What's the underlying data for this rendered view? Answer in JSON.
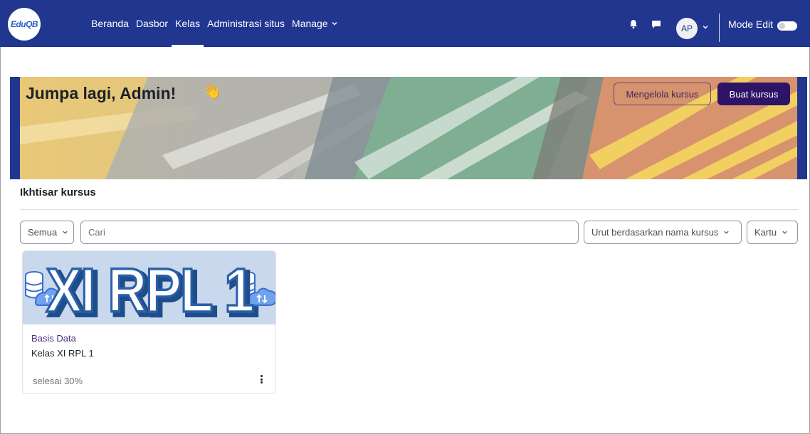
{
  "logo": {
    "text": "EduQB"
  },
  "nav": {
    "links": [
      "Beranda",
      "Dasbor",
      "Kelas",
      "Administrasi situs",
      "Manage"
    ],
    "active": "Kelas"
  },
  "user": {
    "initials": "AP"
  },
  "mode_edit_label": "Mode Edit",
  "banner": {
    "greeting": "Jumpa lagi, Admin!",
    "wave": "👋",
    "manage_button": "Mengelola kursus",
    "create_button": "Buat kursus"
  },
  "overview": {
    "title": "Ikhtisar kursus",
    "filter": "Semua",
    "search_placeholder": "Cari",
    "sort": "Urut berdasarkan nama kursus",
    "view": "Kartu"
  },
  "courses": [
    {
      "image_text": "XI RPL 1",
      "category": "Basis Data",
      "name": "Kelas XI RPL 1",
      "progress_label": "selesai 30%",
      "progress": 30
    }
  ],
  "colors": {
    "navbar": "#20368f",
    "primary_button": "#2d1466",
    "course_category": "#4b2e83"
  }
}
